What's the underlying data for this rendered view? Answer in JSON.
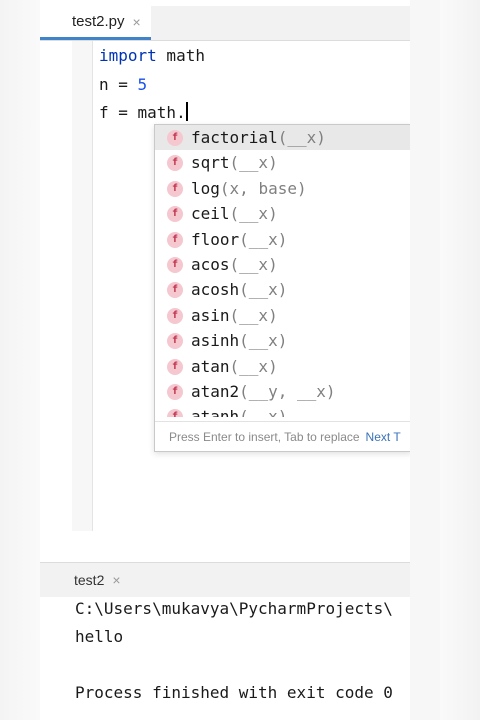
{
  "editor": {
    "tab": {
      "label": "test2.py",
      "close_glyph": "×"
    },
    "code": {
      "line1": {
        "keyword": "import",
        "rest": " math"
      },
      "line2": {
        "prefix": "n = ",
        "number": "5"
      },
      "line3": {
        "text": "f = math."
      }
    }
  },
  "completion": {
    "icon_letter": "f",
    "items": [
      {
        "name": "factorial",
        "params": "(__x)"
      },
      {
        "name": "sqrt",
        "params": "(__x)"
      },
      {
        "name": "log",
        "params": "(x, base)"
      },
      {
        "name": "ceil",
        "params": "(__x)"
      },
      {
        "name": "floor",
        "params": "(__x)"
      },
      {
        "name": "acos",
        "params": "(__x)"
      },
      {
        "name": "acosh",
        "params": "(__x)"
      },
      {
        "name": "asin",
        "params": "(__x)"
      },
      {
        "name": "asinh",
        "params": "(__x)"
      },
      {
        "name": "atan",
        "params": "(__x)"
      },
      {
        "name": "atan2",
        "params": "(__y, __x)"
      },
      {
        "name": "atanh",
        "params": "(__x)"
      }
    ],
    "selected_index": 0,
    "footer_hint": "Press Enter to insert, Tab to replace",
    "footer_link": "Next T"
  },
  "run_panel": {
    "tab": {
      "label": "test2",
      "close_glyph": "×"
    },
    "output": {
      "line1": "C:\\Users\\mukavya\\PycharmProjects\\",
      "line2": "hello",
      "line3": "Process finished with exit code 0"
    }
  },
  "colors": {
    "keyword": "#0033b3",
    "number": "#1750eb",
    "function_icon_bg": "#f5c7cf",
    "selection": "#e8e8e8",
    "tab_underline": "#4083c9",
    "link": "#3a72b8"
  }
}
